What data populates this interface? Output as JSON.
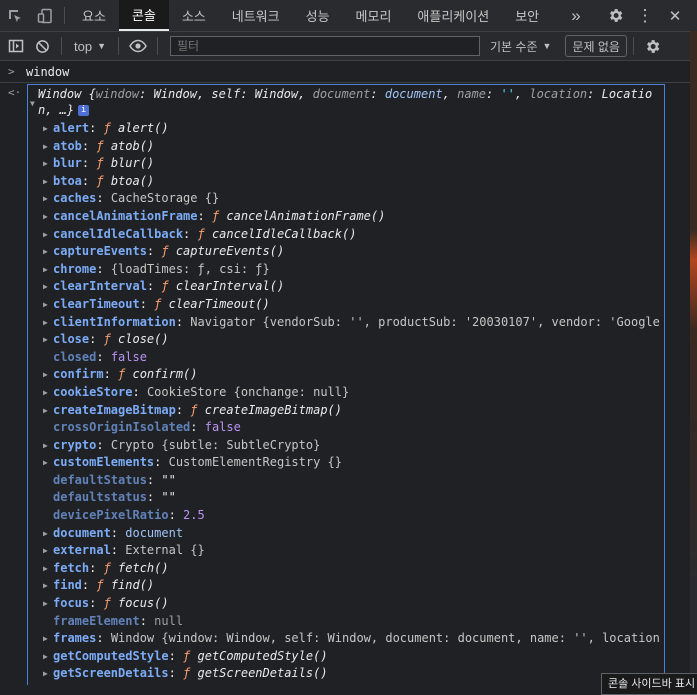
{
  "tabs": [
    {
      "label": "요소",
      "active": false
    },
    {
      "label": "콘솔",
      "active": true
    },
    {
      "label": "소스",
      "active": false
    },
    {
      "label": "네트워크",
      "active": false
    },
    {
      "label": "성능",
      "active": false
    },
    {
      "label": "메모리",
      "active": false
    },
    {
      "label": "애플리케이션",
      "active": false
    },
    {
      "label": "보안",
      "active": false
    }
  ],
  "tabbar": {
    "more": "»",
    "settings_icon": "gear-icon",
    "menu": "⋮",
    "close": "✕"
  },
  "toolbar": {
    "context": "top",
    "filter_placeholder": "필터",
    "levels": "기본 수준",
    "issues": "문제 없음"
  },
  "console": {
    "input_expression": "window",
    "tooltip": "콘솔 사이드바 표시"
  },
  "result_head": {
    "prefix": "Window {",
    "k1": "window",
    "v1": "Window",
    "k2": "self",
    "v2": "Window",
    "k3": "document",
    "v3": "document",
    "k4": "name",
    "v4": "''",
    "k5": "location",
    "v5": "Location, …}"
  },
  "rows": [
    {
      "key": "alert",
      "expandable": true,
      "type": "fn",
      "value": "alert()"
    },
    {
      "key": "atob",
      "expandable": true,
      "type": "fn",
      "value": "atob()"
    },
    {
      "key": "blur",
      "expandable": true,
      "type": "fn",
      "value": "blur()"
    },
    {
      "key": "btoa",
      "expandable": true,
      "type": "fn",
      "value": "btoa()"
    },
    {
      "key": "caches",
      "expandable": true,
      "type": "obj",
      "value": "CacheStorage {}"
    },
    {
      "key": "cancelAnimationFrame",
      "expandable": true,
      "type": "fn",
      "value": "cancelAnimationFrame()"
    },
    {
      "key": "cancelIdleCallback",
      "expandable": true,
      "type": "fn",
      "value": "cancelIdleCallback()"
    },
    {
      "key": "captureEvents",
      "expandable": true,
      "type": "fn",
      "value": "captureEvents()"
    },
    {
      "key": "chrome",
      "expandable": true,
      "type": "chrome",
      "value": "{loadTimes: ƒ, csi: ƒ}"
    },
    {
      "key": "clearInterval",
      "expandable": true,
      "type": "fn",
      "value": "clearInterval()"
    },
    {
      "key": "clearTimeout",
      "expandable": true,
      "type": "fn",
      "value": "clearTimeout()"
    },
    {
      "key": "clientInformation",
      "expandable": true,
      "type": "nav",
      "value": "Navigator {vendorSub: '', productSub: '20030107', vendor: 'Google"
    },
    {
      "key": "close",
      "expandable": true,
      "type": "fn",
      "value": "close()"
    },
    {
      "key": "closed",
      "expandable": false,
      "type": "bool",
      "value": "false"
    },
    {
      "key": "confirm",
      "expandable": true,
      "type": "fn",
      "value": "confirm()"
    },
    {
      "key": "cookieStore",
      "expandable": true,
      "type": "obj",
      "value": "CookieStore {onchange: null}"
    },
    {
      "key": "createImageBitmap",
      "expandable": true,
      "type": "fn",
      "value": "createImageBitmap()"
    },
    {
      "key": "crossOriginIsolated",
      "expandable": false,
      "type": "bool",
      "value": "false"
    },
    {
      "key": "crypto",
      "expandable": true,
      "type": "obj",
      "value": "Crypto {subtle: SubtleCrypto}"
    },
    {
      "key": "customElements",
      "expandable": true,
      "type": "obj",
      "value": "CustomElementRegistry {}"
    },
    {
      "key": "defaultStatus",
      "expandable": false,
      "type": "str",
      "value": "\"\""
    },
    {
      "key": "defaultstatus",
      "expandable": false,
      "type": "str",
      "value": "\"\""
    },
    {
      "key": "devicePixelRatio",
      "expandable": false,
      "type": "num",
      "value": "2.5"
    },
    {
      "key": "document",
      "expandable": true,
      "type": "doc",
      "value": "document"
    },
    {
      "key": "external",
      "expandable": true,
      "type": "obj",
      "value": "External {}"
    },
    {
      "key": "fetch",
      "expandable": true,
      "type": "fn",
      "value": "fetch()"
    },
    {
      "key": "find",
      "expandable": true,
      "type": "fn",
      "value": "find()"
    },
    {
      "key": "focus",
      "expandable": true,
      "type": "fn",
      "value": "focus()"
    },
    {
      "key": "frameElement",
      "expandable": false,
      "type": "null",
      "value": "null"
    },
    {
      "key": "frames",
      "expandable": true,
      "type": "win",
      "value": "Window {window: Window, self: Window, document: document, name: '', location"
    },
    {
      "key": "getComputedStyle",
      "expandable": true,
      "type": "fn",
      "value": "getComputedStyle()"
    },
    {
      "key": "getScreenDetails",
      "expandable": true,
      "type": "fn",
      "value": "getScreenDetails()"
    }
  ]
}
